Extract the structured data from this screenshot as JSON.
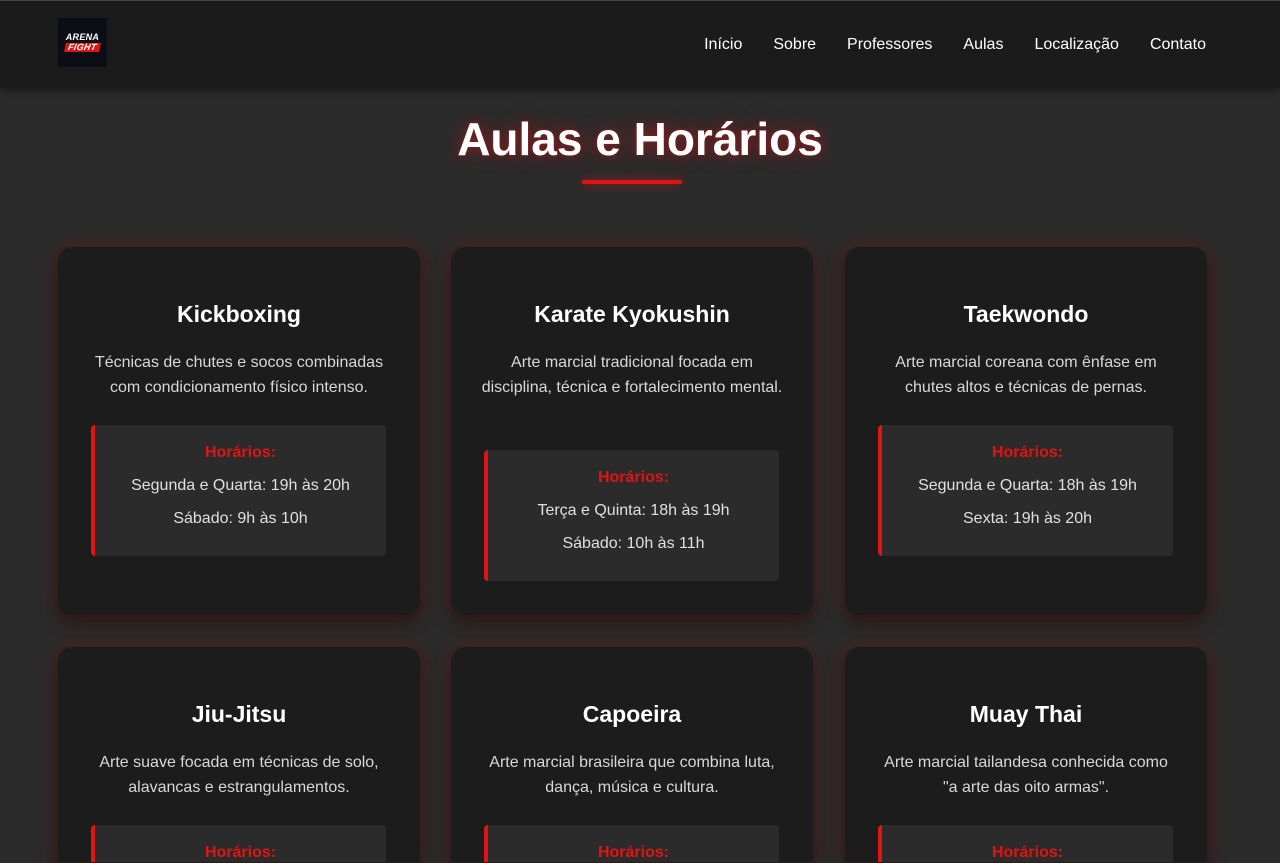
{
  "brand": {
    "logo_top": "ARENA",
    "logo_bottom": "FIGHT"
  },
  "nav": [
    {
      "label": "Início"
    },
    {
      "label": "Sobre"
    },
    {
      "label": "Professores"
    },
    {
      "label": "Aulas"
    },
    {
      "label": "Localização"
    },
    {
      "label": "Contato"
    }
  ],
  "section": {
    "title": "Aulas e Horários"
  },
  "colors": {
    "accent": "#e11414",
    "page_bg": "#2b2b2b",
    "card_bg": "#1c1c1c",
    "nav_bg": "#1b1b1b"
  },
  "classes": [
    {
      "name": "Kickboxing",
      "description": "Técnicas de chutes e socos combinadas com condicionamento físico intenso.",
      "schedule_label": "Horários:",
      "schedule": [
        "Segunda e Quarta: 19h às 20h",
        "Sábado: 9h às 10h"
      ]
    },
    {
      "name": "Karate Kyokushin",
      "description": "Arte marcial tradicional focada em disciplina, técnica e fortalecimento mental.",
      "schedule_label": "Horários:",
      "schedule": [
        "Terça e Quinta: 18h às 19h",
        "Sábado: 10h às 11h"
      ]
    },
    {
      "name": "Taekwondo",
      "description": "Arte marcial coreana com ênfase em chutes altos e técnicas de pernas.",
      "schedule_label": "Horários:",
      "schedule": [
        "Segunda e Quarta: 18h às 19h",
        "Sexta: 19h às 20h"
      ]
    },
    {
      "name": "Jiu-Jitsu",
      "description": "Arte suave focada em técnicas de solo, alavancas e estrangulamentos.",
      "schedule_label": "Horários:",
      "schedule": []
    },
    {
      "name": "Capoeira",
      "description": "Arte marcial brasileira que combina luta, dança, música e cultura.",
      "schedule_label": "Horários:",
      "schedule": []
    },
    {
      "name": "Muay Thai",
      "description": "Arte marcial tailandesa conhecida como \"a arte das oito armas\".",
      "schedule_label": "Horários:",
      "schedule": []
    }
  ]
}
